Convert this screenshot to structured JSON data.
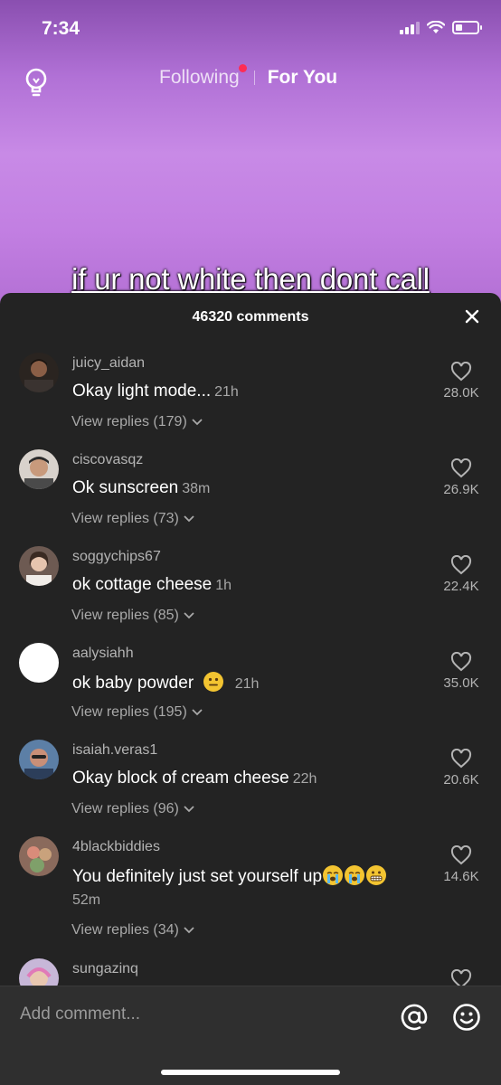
{
  "status": {
    "time": "7:34"
  },
  "nav": {
    "following": "Following",
    "for_you": "For You"
  },
  "video": {
    "caption": "if ur not white then dont call"
  },
  "comments_sheet": {
    "count_label": "46320 comments",
    "comments": [
      {
        "username": "juicy_aidan",
        "text": "Okay light mode...",
        "time": "21h",
        "replies": "View replies (179)",
        "likes": "28.0K"
      },
      {
        "username": "ciscovasqz",
        "text": "Ok sunscreen",
        "time": "38m",
        "replies": "View replies (73)",
        "likes": "26.9K"
      },
      {
        "username": "soggychips67",
        "text": "ok cottage cheese",
        "time": "1h",
        "replies": "View replies (85)",
        "likes": "22.4K"
      },
      {
        "username": "aalysiahh",
        "text": "ok baby powder",
        "time": "21h",
        "replies": "View replies (195)",
        "likes": "35.0K"
      },
      {
        "username": "isaiah.veras1",
        "text": "Okay block of cream cheese",
        "time": "22h",
        "replies": "View replies (96)",
        "likes": "20.6K"
      },
      {
        "username": "4blackbiddies",
        "text": "You definitely just set yourself up",
        "time": "52m",
        "replies": "View replies (34)",
        "likes": "14.6K"
      },
      {
        "username": "sungazinq"
      }
    ]
  },
  "input": {
    "placeholder": "Add comment..."
  },
  "colors": {
    "accent_dot": "#fe2c55",
    "sheet_bg": "#232323",
    "video_purple": "#c88ae6"
  }
}
